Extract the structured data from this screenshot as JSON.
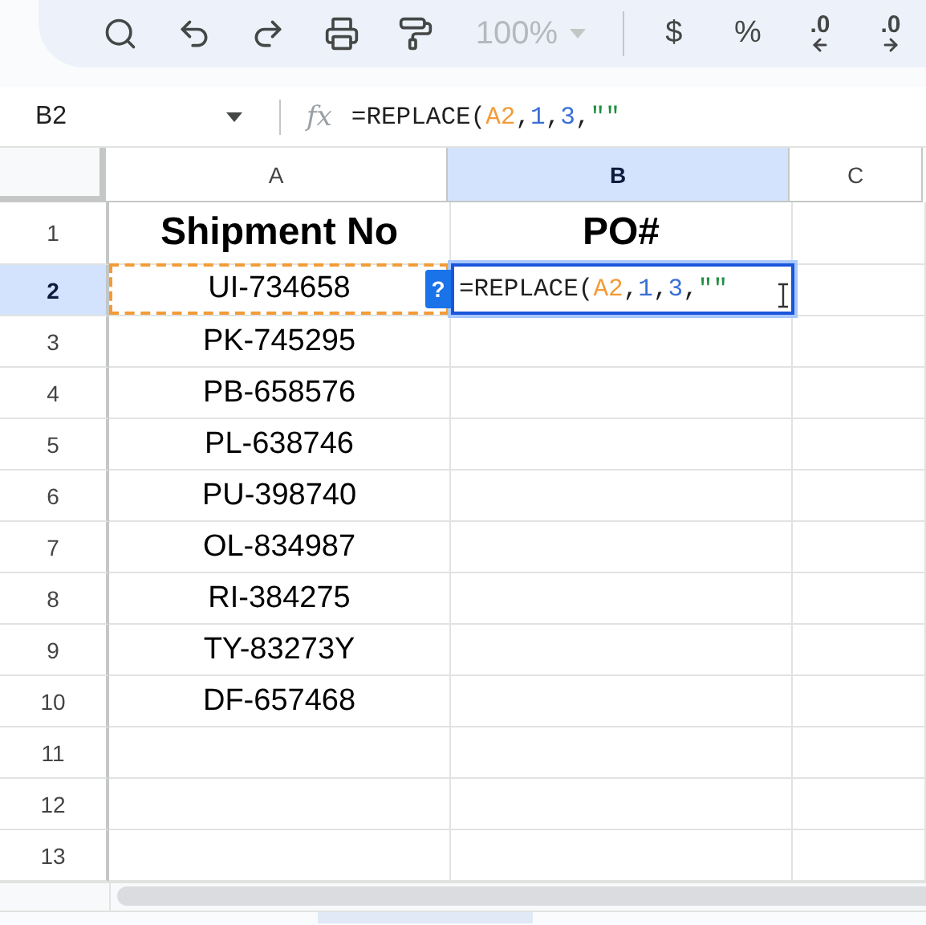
{
  "toolbar": {
    "items": [
      {
        "kind": "search"
      },
      {
        "kind": "undo"
      },
      {
        "kind": "redo"
      },
      {
        "kind": "print"
      },
      {
        "kind": "paint"
      },
      {
        "kind": "zoom",
        "text": "100%",
        "disabled": true
      },
      {
        "kind": "divider"
      },
      {
        "kind": "text",
        "text": "$"
      },
      {
        "kind": "text",
        "text": "%"
      },
      {
        "kind": "decimal-down",
        "text": ".0"
      },
      {
        "kind": "decimal-up",
        "text": ".0"
      }
    ]
  },
  "formula_bar": {
    "cell_ref": "B2",
    "fx_label": "fx",
    "tokens": [
      {
        "text": "=REPLACE(",
        "color": "#1f1f1f"
      },
      {
        "text": "A2",
        "color": "#f29b38"
      },
      {
        "text": ",",
        "color": "#1f1f1f"
      },
      {
        "text": "1",
        "color": "#3b6fd6"
      },
      {
        "text": ",",
        "color": "#1f1f1f"
      },
      {
        "text": "3",
        "color": "#3b6fd6"
      },
      {
        "text": ",",
        "color": "#1f1f1f"
      },
      {
        "text": "\"\"",
        "color": "#1e8e3e"
      }
    ]
  },
  "columns": [
    {
      "label": "A",
      "selected": false
    },
    {
      "label": "B",
      "selected": true
    },
    {
      "label": "C",
      "selected": false
    }
  ],
  "rows": [
    {
      "number": "1",
      "selected": false,
      "kind": "header",
      "cells": [
        {
          "text": "Shipment No"
        },
        {
          "text": "PO#"
        }
      ]
    },
    {
      "number": "2",
      "selected": true,
      "kind": "data",
      "cells": [
        {
          "text": "UI-734658",
          "referenced": true
        },
        {
          "editor": true,
          "hint": "?",
          "tokens": [
            {
              "text": "=REPLACE(",
              "color": "#1f1f1f"
            },
            {
              "text": "A2",
              "color": "#f29b38"
            },
            {
              "text": ",",
              "color": "#1f1f1f"
            },
            {
              "text": "1",
              "color": "#3b6fd6"
            },
            {
              "text": ",",
              "color": "#1f1f1f"
            },
            {
              "text": "3",
              "color": "#3b6fd6"
            },
            {
              "text": ",",
              "color": "#1f1f1f"
            },
            {
              "text": "\"\"",
              "color": "#1e8e3e"
            }
          ]
        }
      ]
    },
    {
      "number": "3",
      "selected": false,
      "kind": "data",
      "cells": [
        {
          "text": "PK-745295"
        }
      ]
    },
    {
      "number": "4",
      "selected": false,
      "kind": "data",
      "cells": [
        {
          "text": "PB-658576"
        }
      ]
    },
    {
      "number": "5",
      "selected": false,
      "kind": "data",
      "cells": [
        {
          "text": "PL-638746"
        }
      ]
    },
    {
      "number": "6",
      "selected": false,
      "kind": "data",
      "cells": [
        {
          "text": "PU-398740"
        }
      ]
    },
    {
      "number": "7",
      "selected": false,
      "kind": "data",
      "cells": [
        {
          "text": "OL-834987"
        }
      ]
    },
    {
      "number": "8",
      "selected": false,
      "kind": "data",
      "cells": [
        {
          "text": "RI-384275"
        }
      ]
    },
    {
      "number": "9",
      "selected": false,
      "kind": "data",
      "cells": [
        {
          "text": "TY-83273Y"
        }
      ]
    },
    {
      "number": "10",
      "selected": false,
      "kind": "data",
      "cells": [
        {
          "text": "DF-657468"
        }
      ]
    },
    {
      "number": "11",
      "selected": false,
      "kind": "data",
      "cells": []
    },
    {
      "number": "12",
      "selected": false,
      "kind": "data",
      "cells": []
    },
    {
      "number": "13",
      "selected": false,
      "kind": "data",
      "cells": []
    }
  ]
}
